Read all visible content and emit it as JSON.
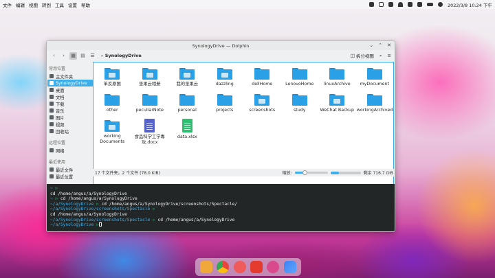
{
  "menubar": {
    "items": [
      "文件",
      "编辑",
      "视图",
      "转到",
      "工具",
      "设置",
      "帮助"
    ]
  },
  "tray": {
    "clock": "2022/3/8  10:24 下午"
  },
  "window": {
    "title": "SynologyDrive — Dolphin"
  },
  "toolbar": {
    "breadcrumb": "SynologyDrive",
    "split_label": "拆分视图"
  },
  "sidebar": {
    "sections": [
      {
        "title": "常用位置",
        "items": [
          "主文件夹",
          "SynologyDrive",
          "桌面",
          "文档",
          "下载",
          "音乐",
          "图片",
          "视频",
          "回收站"
        ]
      },
      {
        "title": "远程位置",
        "items": [
          "网络"
        ]
      },
      {
        "title": "最近使用",
        "items": [
          "最近文件",
          "最近位置"
        ]
      }
    ]
  },
  "files": [
    {
      "name": "单反原图",
      "kind": "folder-img"
    },
    {
      "name": "坚果云相册",
      "kind": "folder-img"
    },
    {
      "name": "我的坚果云",
      "kind": "folder-img"
    },
    {
      "name": "dazzling",
      "kind": "folder-img"
    },
    {
      "name": "dellHome",
      "kind": "folder"
    },
    {
      "name": "LenovoHome",
      "kind": "folder"
    },
    {
      "name": "linuxArchive",
      "kind": "folder"
    },
    {
      "name": "myDocument",
      "kind": "folder"
    },
    {
      "name": "other",
      "kind": "folder"
    },
    {
      "name": "peculiarNote",
      "kind": "folder"
    },
    {
      "name": "personal",
      "kind": "folder"
    },
    {
      "name": "projects",
      "kind": "folder"
    },
    {
      "name": "screenshots",
      "kind": "folder-img"
    },
    {
      "name": "study",
      "kind": "folder"
    },
    {
      "name": "WeChat Backup",
      "kind": "folder-img"
    },
    {
      "name": "workingArchived",
      "kind": "folder"
    },
    {
      "name": "working Documents",
      "kind": "folder-img"
    },
    {
      "name": "食品科学工学專攻.docx",
      "kind": "word"
    },
    {
      "name": "data.xlsx",
      "kind": "xls"
    }
  ],
  "status": {
    "summary": "17 个文件夹，2 个文件 (78.0 KiB)",
    "zoom_label": "缩放:",
    "free": "剩余 716.7 GiB",
    "zoom_level": 0.3,
    "disk_used": 0.28
  },
  "terminal": {
    "lines": [
      {
        "prompt": "~ ",
        "cmd": ""
      },
      {
        "prompt": "",
        "cmd": " cd /home/angus/a/SynologyDrive"
      },
      {
        "prompt": "~ ",
        "cmd": " cd /home/angus/a/SynologyDrive"
      },
      {
        "prompt": "~/a/SynologyDrive ",
        "cmd": " cd /home/angus/a/SynologyDrive/screenshots/Spectacle/"
      },
      {
        "prompt": "~/a/SynologyDrive/screenshots/Spectacle ",
        "cmd": ""
      },
      {
        "prompt": "",
        "cmd": " cd /home/angus/a/SynologyDrive"
      },
      {
        "prompt": "~/a/SynologyDrive/screenshots/Spectacle ",
        "cmd": " cd /home/angus/a/SynologyDrive"
      },
      {
        "prompt": "~/a/SynologyDrive ",
        "cmd": ""
      }
    ]
  },
  "dock": {
    "items": [
      "files-icon",
      "chrome-icon",
      "toggle-app-icon",
      "xmind-icon",
      "store-icon",
      "editor-icon"
    ]
  }
}
